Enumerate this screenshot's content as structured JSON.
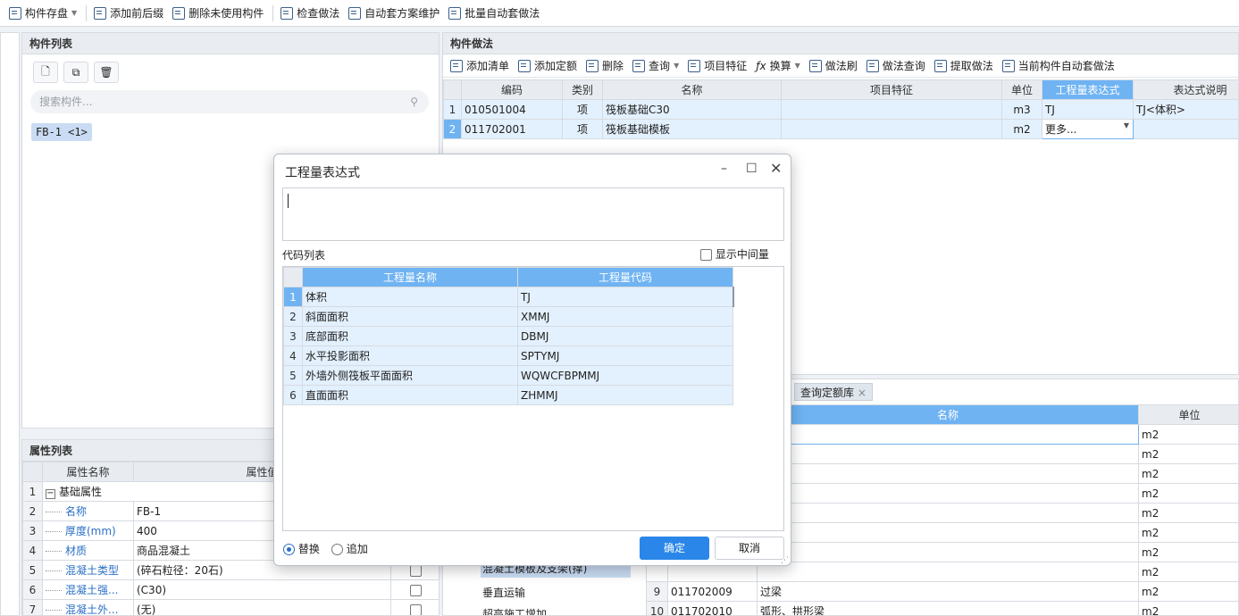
{
  "toolbar": {
    "items": [
      "构件存盘",
      "添加前后缀",
      "删除未使用构件",
      "检查做法",
      "自动套方案维护",
      "批量自动套做法"
    ]
  },
  "component_list": {
    "title": "构件列表",
    "search_placeholder": "搜索构件...",
    "selected_tag": "FB-1 <1>"
  },
  "method_panel": {
    "title": "构件做法",
    "toolbar": [
      "添加清单",
      "添加定额",
      "删除",
      "查询",
      "项目特征",
      "换算",
      "做法刷",
      "做法查询",
      "提取做法",
      "当前构件自动套做法"
    ],
    "columns": [
      "编码",
      "类别",
      "名称",
      "项目特征",
      "单位",
      "工程量表达式",
      "表达式说明"
    ],
    "rows": [
      {
        "num": "1",
        "code": "010501004",
        "type": "项",
        "name": "筏板基础C30",
        "feature": "",
        "unit": "m3",
        "expr": "TJ",
        "desc": "TJ<体积>"
      },
      {
        "num": "2",
        "code": "011702001",
        "type": "项",
        "name": "筏板基础模板",
        "feature": "",
        "unit": "m2",
        "expr": "更多...",
        "desc": ""
      }
    ]
  },
  "attr_panel": {
    "title": "属性列表",
    "columns": [
      "属性名称",
      "属性值"
    ],
    "rows": [
      {
        "num": "1",
        "name": "基础属性",
        "value": "",
        "group": true
      },
      {
        "num": "2",
        "name": "名称",
        "value": "FB-1"
      },
      {
        "num": "3",
        "name": "厚度(mm)",
        "value": "400"
      },
      {
        "num": "4",
        "name": "材质",
        "value": "商品混凝土"
      },
      {
        "num": "5",
        "name": "混凝土类型",
        "value": "(碎石粒径：20石)"
      },
      {
        "num": "6",
        "name": "混凝土强...",
        "value": "(C30)"
      },
      {
        "num": "7",
        "name": "混凝土外...",
        "value": "(无)"
      }
    ]
  },
  "query_panel": {
    "tab_label": "查询定额库",
    "tree_items": [
      "混凝土模板及支架(撑)",
      "垂直运输",
      "超高施工增加"
    ],
    "columns": [
      "名称",
      "单位"
    ],
    "units": [
      "m2",
      "m2",
      "m2",
      "m2",
      "m2",
      "m2",
      "m2",
      "m2"
    ],
    "rows": [
      {
        "num": "9",
        "code": "011702009",
        "name": "过梁",
        "unit": "m2"
      },
      {
        "num": "10",
        "code": "011702010",
        "name": "弧形、拱形梁",
        "unit": "m2"
      }
    ]
  },
  "dialog": {
    "title": "工程量表达式",
    "code_list_label": "代码列表",
    "show_intermediate": "显示中间量",
    "columns": [
      "工程量名称",
      "工程量代码"
    ],
    "rows": [
      {
        "num": "1",
        "name": "体积",
        "code": "TJ"
      },
      {
        "num": "2",
        "name": "斜面面积",
        "code": "XMMJ"
      },
      {
        "num": "3",
        "name": "底部面积",
        "code": "DBMJ"
      },
      {
        "num": "4",
        "name": "水平投影面积",
        "code": "SPTYMJ"
      },
      {
        "num": "5",
        "name": "外墙外侧筏板平面面积",
        "code": "WQWCFBPMMJ"
      },
      {
        "num": "6",
        "name": "直面面积",
        "code": "ZHMMJ"
      }
    ],
    "radio_replace": "替换",
    "radio_append": "追加",
    "ok": "确定",
    "cancel": "取消"
  }
}
